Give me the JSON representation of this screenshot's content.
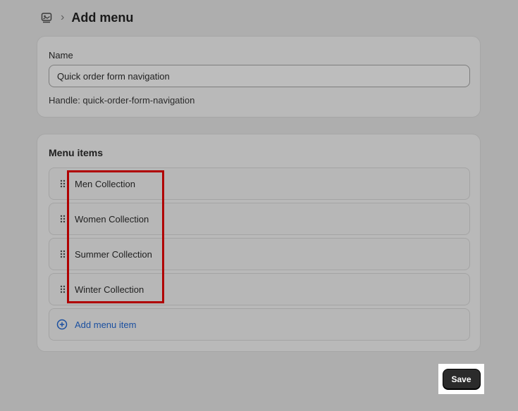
{
  "breadcrumb": {
    "icon": "menu-icon",
    "separator": "›",
    "title": "Add menu"
  },
  "name_section": {
    "label": "Name",
    "value": "Quick order form navigation",
    "handle": "Handle: quick-order-form-navigation"
  },
  "menu_section": {
    "heading": "Menu items",
    "items": [
      {
        "label": "Men Collection",
        "icon": "drag-handle-icon"
      },
      {
        "label": "Women Collection",
        "icon": "drag-handle-icon"
      },
      {
        "label": "Summer Collection",
        "icon": "drag-handle-icon"
      },
      {
        "label": "Winter Collection",
        "icon": "drag-handle-icon"
      }
    ],
    "add_label": "Add menu item",
    "add_icon": "plus-circle-icon"
  },
  "save_label": "Save",
  "colors": {
    "background": "#aeaeae",
    "card": "#b9b9b9",
    "link": "#1a4fa0",
    "highlight": "#b00000",
    "save_button": "#2b2b2b"
  }
}
